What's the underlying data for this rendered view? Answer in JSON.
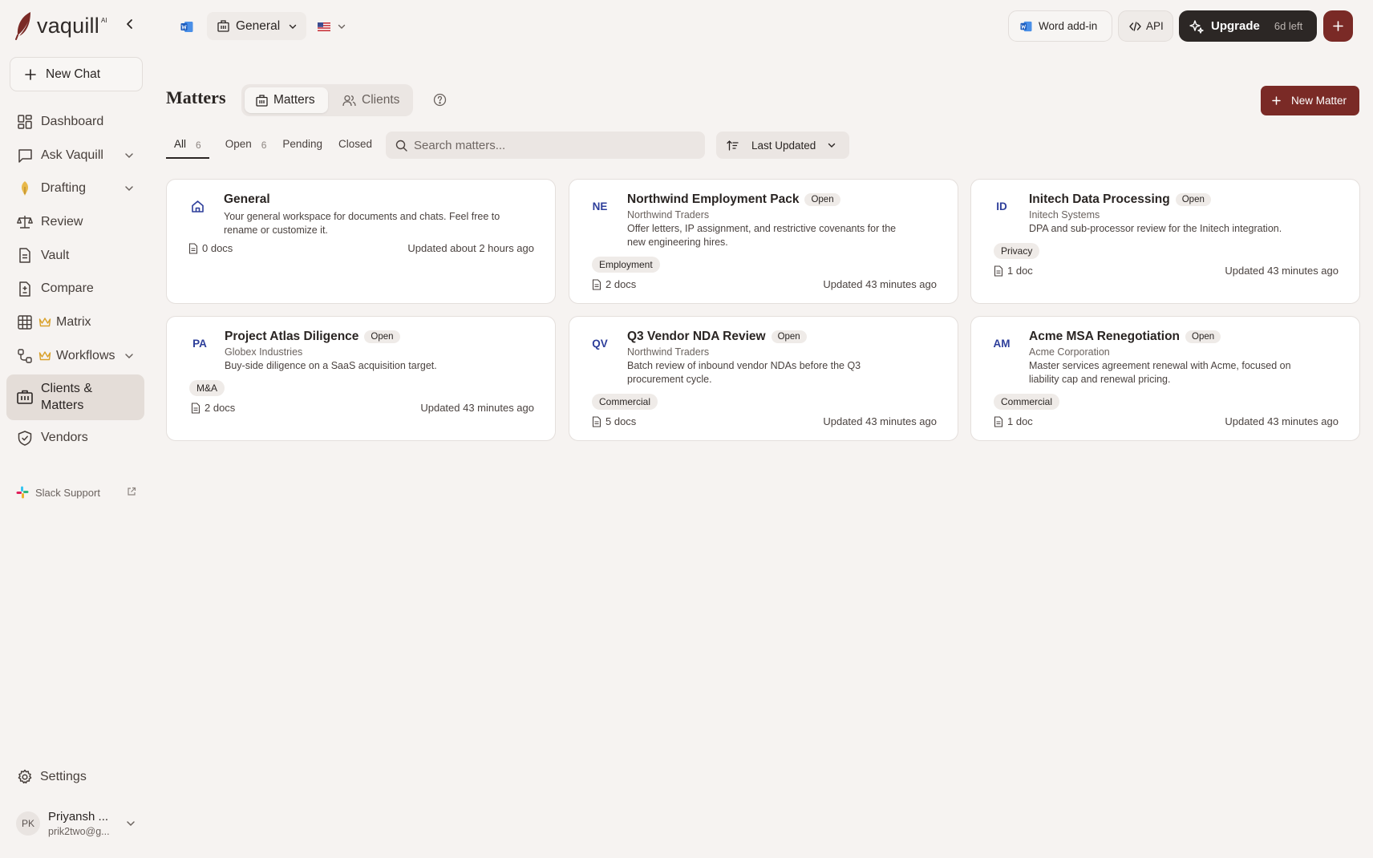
{
  "app": {
    "logo_text": "vaquill",
    "logo_sup": "AI"
  },
  "sidebar": {
    "new_chat": "New Chat",
    "items": [
      {
        "label": "Dashboard",
        "icon": "dashboard-icon",
        "chevron": false,
        "crown": false
      },
      {
        "label": "Ask Vaquill",
        "icon": "chat-icon",
        "chevron": true,
        "crown": false
      },
      {
        "label": "Drafting",
        "icon": "pen-icon",
        "chevron": true,
        "crown": false
      },
      {
        "label": "Review",
        "icon": "scale-icon",
        "chevron": false,
        "crown": false
      },
      {
        "label": "Vault",
        "icon": "document-icon",
        "chevron": false,
        "crown": false
      },
      {
        "label": "Compare",
        "icon": "compare-icon",
        "chevron": false,
        "crown": false
      },
      {
        "label": "Matrix",
        "icon": "grid-icon",
        "chevron": false,
        "crown": true
      },
      {
        "label": "Workflows",
        "icon": "workflow-icon",
        "chevron": true,
        "crown": true
      },
      {
        "label": "Clients & Matters",
        "icon": "briefcase-icon",
        "chevron": false,
        "crown": false,
        "active": true
      },
      {
        "label": "Vendors",
        "icon": "shield-icon",
        "chevron": false,
        "crown": false
      }
    ],
    "slack_support": "Slack Support",
    "settings": "Settings",
    "user": {
      "initials": "PK",
      "name": "Priyansh ...",
      "email": "prik2two@g..."
    }
  },
  "topbar": {
    "workspace": "General",
    "word_addin": "Word add-in",
    "api": "API",
    "upgrade": "Upgrade",
    "trial_left": "6d left"
  },
  "header": {
    "title": "Matters",
    "segments": [
      "Matters",
      "Clients"
    ],
    "new_matter": "New Matter"
  },
  "filters": {
    "tabs": [
      {
        "label": "All",
        "count": "6"
      },
      {
        "label": "Open",
        "count": "6"
      },
      {
        "label": "Pending",
        "count": ""
      },
      {
        "label": "Closed",
        "count": ""
      }
    ],
    "search_placeholder": "Search matters...",
    "sort_label": "Last Updated"
  },
  "colors": {
    "accent": "#7a2a26",
    "badge_text": "#2d3e9a",
    "background": "#f6f3f1"
  },
  "matters": [
    {
      "initials": "",
      "title": "General",
      "status": "",
      "client": "",
      "description": "Your general workspace for documents and chats. Feel free to rename or customize it.",
      "tag": "",
      "docs": "0 docs",
      "updated": "Updated about 2 hours ago"
    },
    {
      "initials": "NE",
      "title": "Northwind Employment Pack",
      "status": "Open",
      "client": "Northwind Traders",
      "description": "Offer letters, IP assignment, and restrictive covenants for the new engineering hires.",
      "tag": "Employment",
      "docs": "2 docs",
      "updated": "Updated 43 minutes ago"
    },
    {
      "initials": "ID",
      "title": "Initech Data Processing",
      "status": "Open",
      "client": "Initech Systems",
      "description": "DPA and sub-processor review for the Initech integration.",
      "tag": "Privacy",
      "docs": "1 doc",
      "updated": "Updated 43 minutes ago"
    },
    {
      "initials": "PA",
      "title": "Project Atlas Diligence",
      "status": "Open",
      "client": "Globex Industries",
      "description": "Buy-side diligence on a SaaS acquisition target.",
      "tag": "M&A",
      "docs": "2 docs",
      "updated": "Updated 43 minutes ago"
    },
    {
      "initials": "QV",
      "title": "Q3 Vendor NDA Review",
      "status": "Open",
      "client": "Northwind Traders",
      "description": "Batch review of inbound vendor NDAs before the Q3 procurement cycle.",
      "tag": "Commercial",
      "docs": "5 docs",
      "updated": "Updated 43 minutes ago"
    },
    {
      "initials": "AM",
      "title": "Acme MSA Renegotiation",
      "status": "Open",
      "client": "Acme Corporation",
      "description": "Master services agreement renewal with Acme, focused on liability cap and renewal pricing.",
      "tag": "Commercial",
      "docs": "1 doc",
      "updated": "Updated 43 minutes ago"
    }
  ]
}
